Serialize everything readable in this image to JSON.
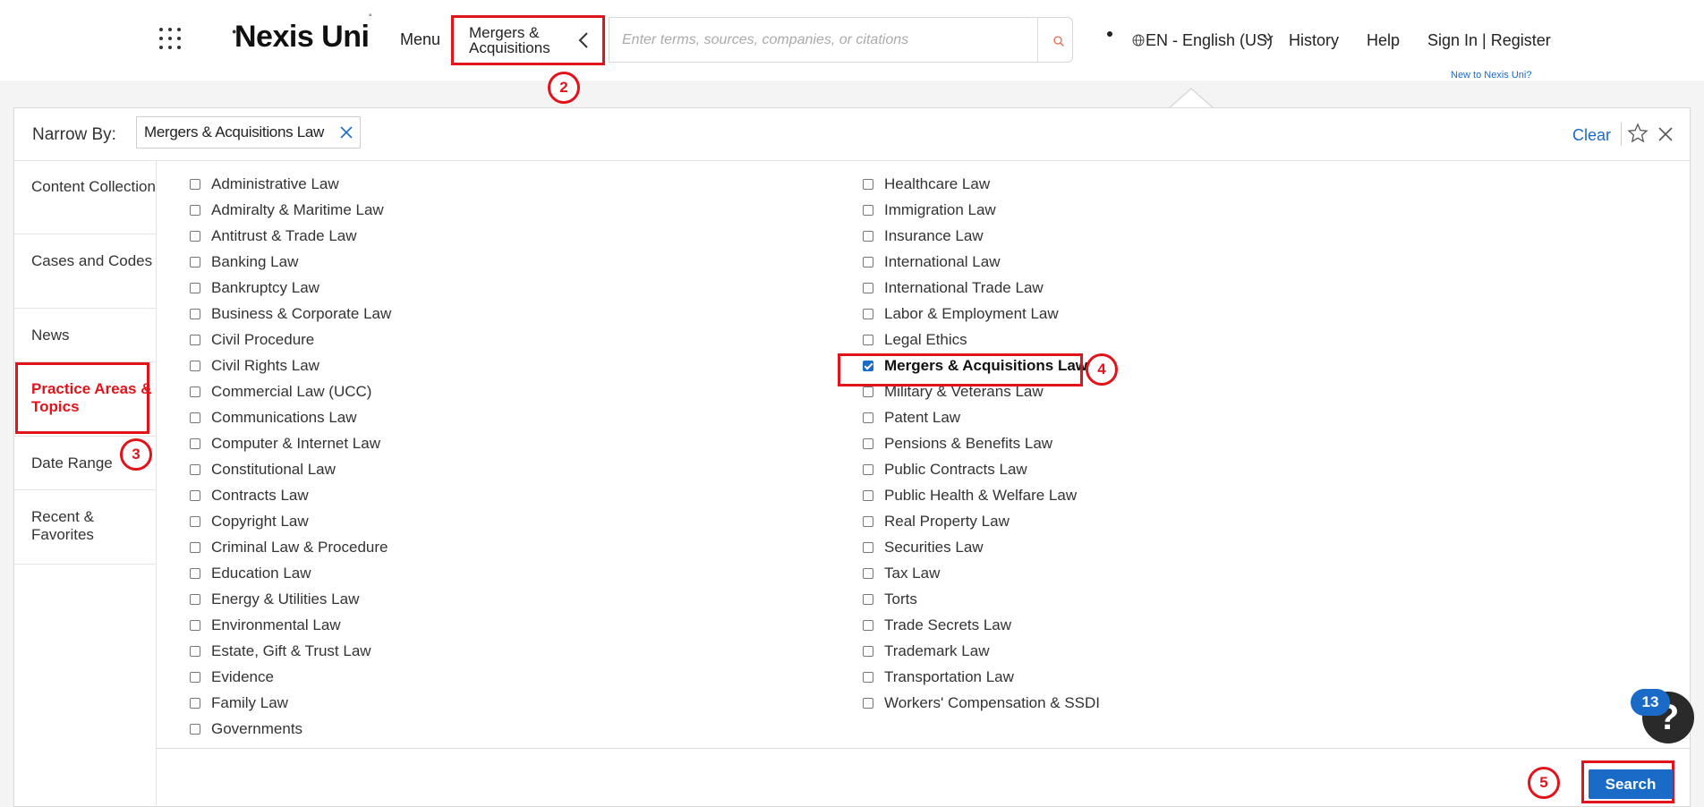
{
  "header": {
    "logo": "Nexis Uni",
    "menu_label": "Menu",
    "context": "Mergers & Acquisitions",
    "search_placeholder": "Enter terms, sources, companies, or citations",
    "language": "EN - English (US)",
    "history": "History",
    "help": "Help",
    "sign_in": "Sign In | Register",
    "new_to": "New to Nexis Uni?"
  },
  "narrow": {
    "label": "Narrow By:",
    "chip": "Mergers & Acquisitions Law",
    "clear": "Clear"
  },
  "sidebar": {
    "items": [
      "Content Collection",
      "Cases and Codes",
      "News",
      "Practice Areas & Topics",
      "Date Range",
      "Recent & Favorites"
    ],
    "active": "Practice Areas & Topics"
  },
  "topics": {
    "left": [
      "Administrative Law",
      "Admiralty & Maritime Law",
      "Antitrust & Trade Law",
      "Banking Law",
      "Bankruptcy Law",
      "Business & Corporate Law",
      "Civil Procedure",
      "Civil Rights Law",
      "Commercial Law (UCC)",
      "Communications Law",
      "Computer & Internet Law",
      "Constitutional Law",
      "Contracts Law",
      "Copyright Law",
      "Criminal Law & Procedure",
      "Education Law",
      "Energy & Utilities Law",
      "Environmental Law",
      "Estate, Gift & Trust Law",
      "Evidence",
      "Family Law",
      "Governments"
    ],
    "right": [
      "Healthcare Law",
      "Immigration Law",
      "Insurance Law",
      "International Law",
      "International Trade Law",
      "Labor & Employment Law",
      "Legal Ethics",
      "Mergers & Acquisitions Law",
      "Military & Veterans Law",
      "Patent Law",
      "Pensions & Benefits Law",
      "Public Contracts Law",
      "Public Health & Welfare Law",
      "Real Property Law",
      "Securities Law",
      "Tax Law",
      "Torts",
      "Trade Secrets Law",
      "Trademark Law",
      "Transportation Law",
      "Workers' Compensation & SSDI"
    ],
    "checked": "Mergers & Acquisitions Law"
  },
  "search_button": "Search",
  "help_badge": "13",
  "help_fab": "?",
  "annotations": [
    "2",
    "3",
    "4",
    "5"
  ],
  "colors": {
    "accent": "#1a6bc7",
    "annotation": "#e0141a"
  }
}
